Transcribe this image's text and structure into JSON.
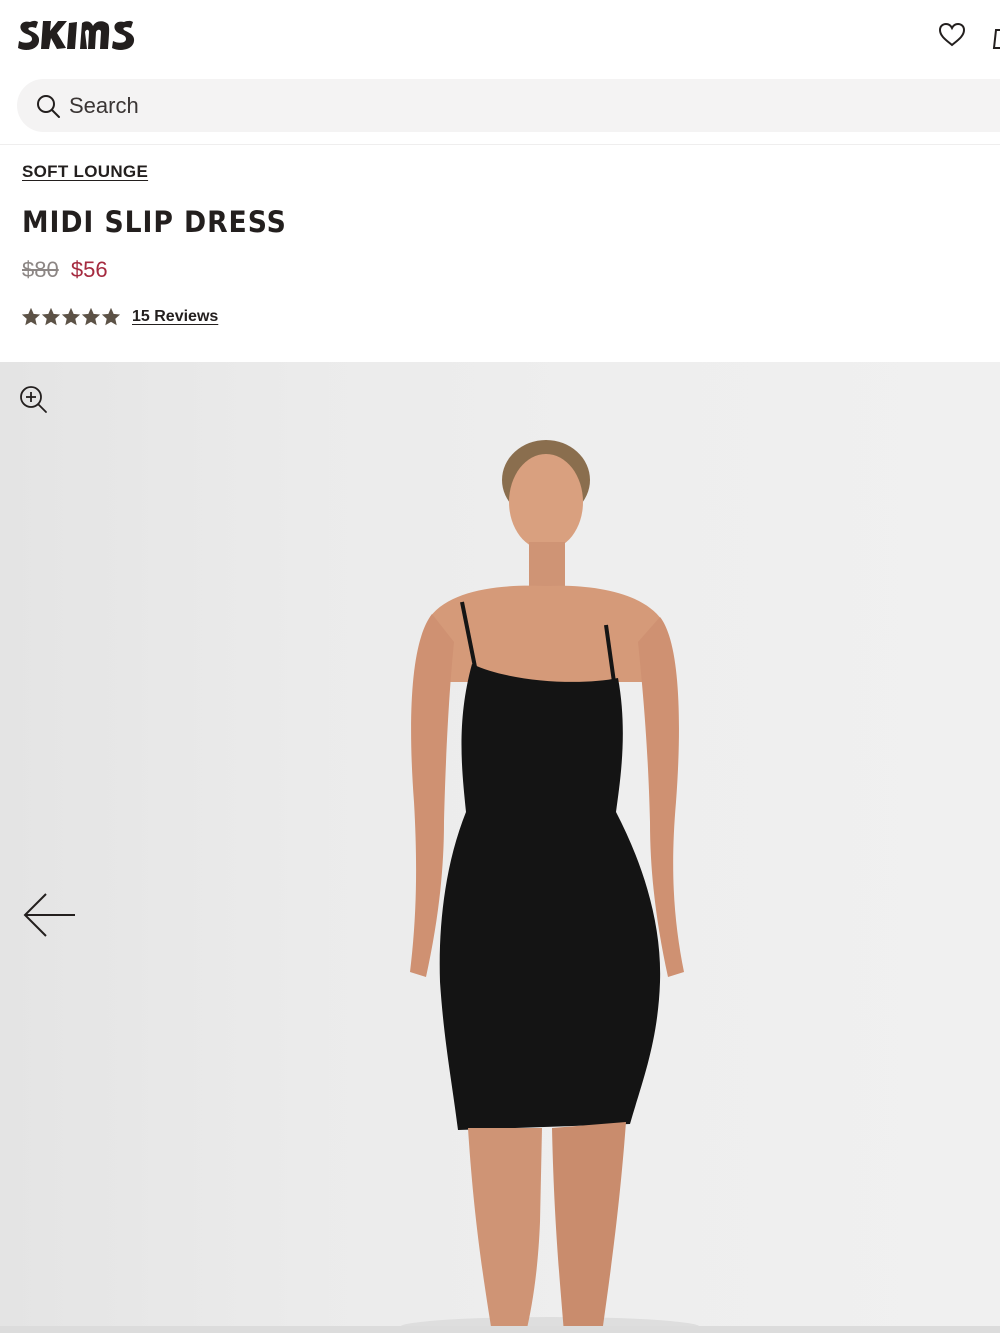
{
  "header": {
    "brand": "SKIMS",
    "icons": [
      "heart-icon",
      "bag-icon"
    ]
  },
  "search": {
    "placeholder": "Search",
    "icon": "search-icon"
  },
  "product": {
    "category": "SOFT LOUNGE",
    "title": "MIDI SLIP DRESS",
    "price_original": "$80",
    "price_sale": "$56",
    "rating": 5,
    "rating_max": 5,
    "reviews_label": "15 Reviews"
  },
  "gallery": {
    "zoom_icon": "zoom-in-icon",
    "prev_icon": "arrow-left-icon"
  },
  "colors": {
    "text": "#231f1e",
    "sale_price": "#a52a3f",
    "original_price": "#8c8684",
    "star": "#5c5246",
    "search_bg": "#f4f3f3",
    "gallery_bg": "#ececec"
  }
}
